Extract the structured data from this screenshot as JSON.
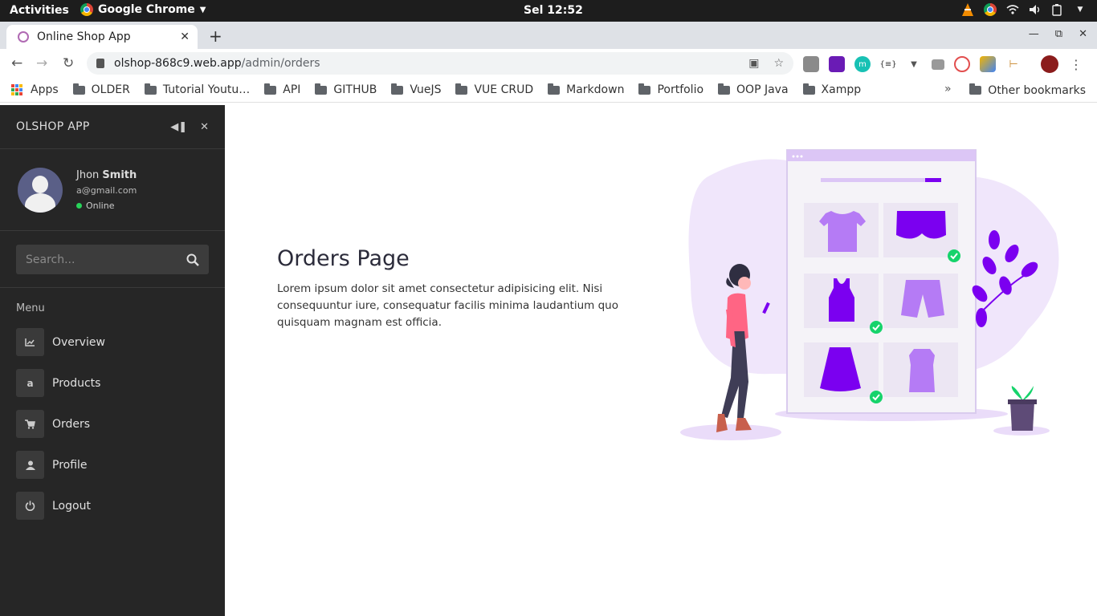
{
  "os": {
    "activities": "Activities",
    "app_name": "Google Chrome",
    "clock": "Sel 12:52"
  },
  "browser": {
    "tab_title": "Online Shop App",
    "url_host": "olshop-868c9.web.app",
    "url_path": "/admin/orders",
    "bookmarks": {
      "apps": "Apps",
      "items": [
        "OLDER",
        "Tutorial Youtu…",
        "API",
        "GITHUB",
        "VueJS",
        "VUE CRUD",
        "Markdown",
        "Portfolio",
        "OOP Java",
        "Xampp"
      ],
      "overflow": "»",
      "other": "Other bookmarks"
    }
  },
  "sidebar": {
    "brand": "OLSHOP APP",
    "user": {
      "first_name": "Jhon",
      "last_name": "Smith",
      "email": "a@gmail.com",
      "status": "Online"
    },
    "search_placeholder": "Search...",
    "menu_label": "Menu",
    "items": [
      {
        "label": "Overview",
        "icon": "chart-icon"
      },
      {
        "label": "Products",
        "icon": "amazon-icon"
      },
      {
        "label": "Orders",
        "icon": "cart-icon"
      },
      {
        "label": "Profile",
        "icon": "user-icon"
      },
      {
        "label": "Logout",
        "icon": "power-icon"
      }
    ]
  },
  "main": {
    "title": "Orders Page",
    "description": "Lorem ipsum dolor sit amet consectetur adipisicing elit. Nisi consequuntur iure, consequatur facilis minima laudantium quo quisquam magnam est officia."
  },
  "colors": {
    "sidebar_bg": "#262626",
    "accent_purple": "#7b00f0",
    "light_purple": "#b57bf5",
    "online_green": "#28d35a"
  }
}
